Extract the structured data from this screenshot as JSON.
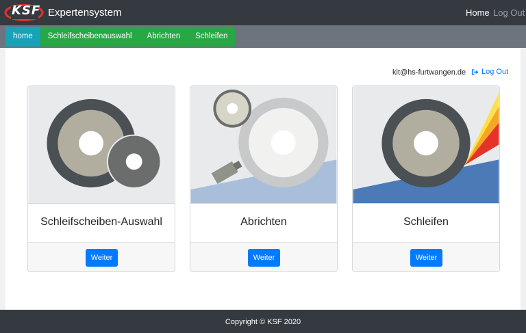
{
  "navbar": {
    "logo_text": "KSF",
    "brand": "Expertensystem",
    "home": "Home",
    "logout": "Log Out"
  },
  "tabs": [
    {
      "label": "home",
      "active": true
    },
    {
      "label": "Schleifscheibenauswahl",
      "active": false
    },
    {
      "label": "Abrichten",
      "active": false
    },
    {
      "label": "Schleifen",
      "active": false
    }
  ],
  "user": {
    "email": "kit@hs-furtwangen.de",
    "logout": "Log Out"
  },
  "cards": [
    {
      "title": "Schleifscheiben-Auswahl",
      "button": "Weiter"
    },
    {
      "title": "Abrichten",
      "button": "Weiter"
    },
    {
      "title": "Schleifen",
      "button": "Weiter"
    }
  ],
  "footer": {
    "copyright": "Copyright © KSF 2020"
  },
  "colors": {
    "navbar": "#343a40",
    "subbar": "#6c757d",
    "tab_active": "#17a2b8",
    "tab": "#28a745",
    "button": "#007bff",
    "logo_red": "#e5332a"
  }
}
